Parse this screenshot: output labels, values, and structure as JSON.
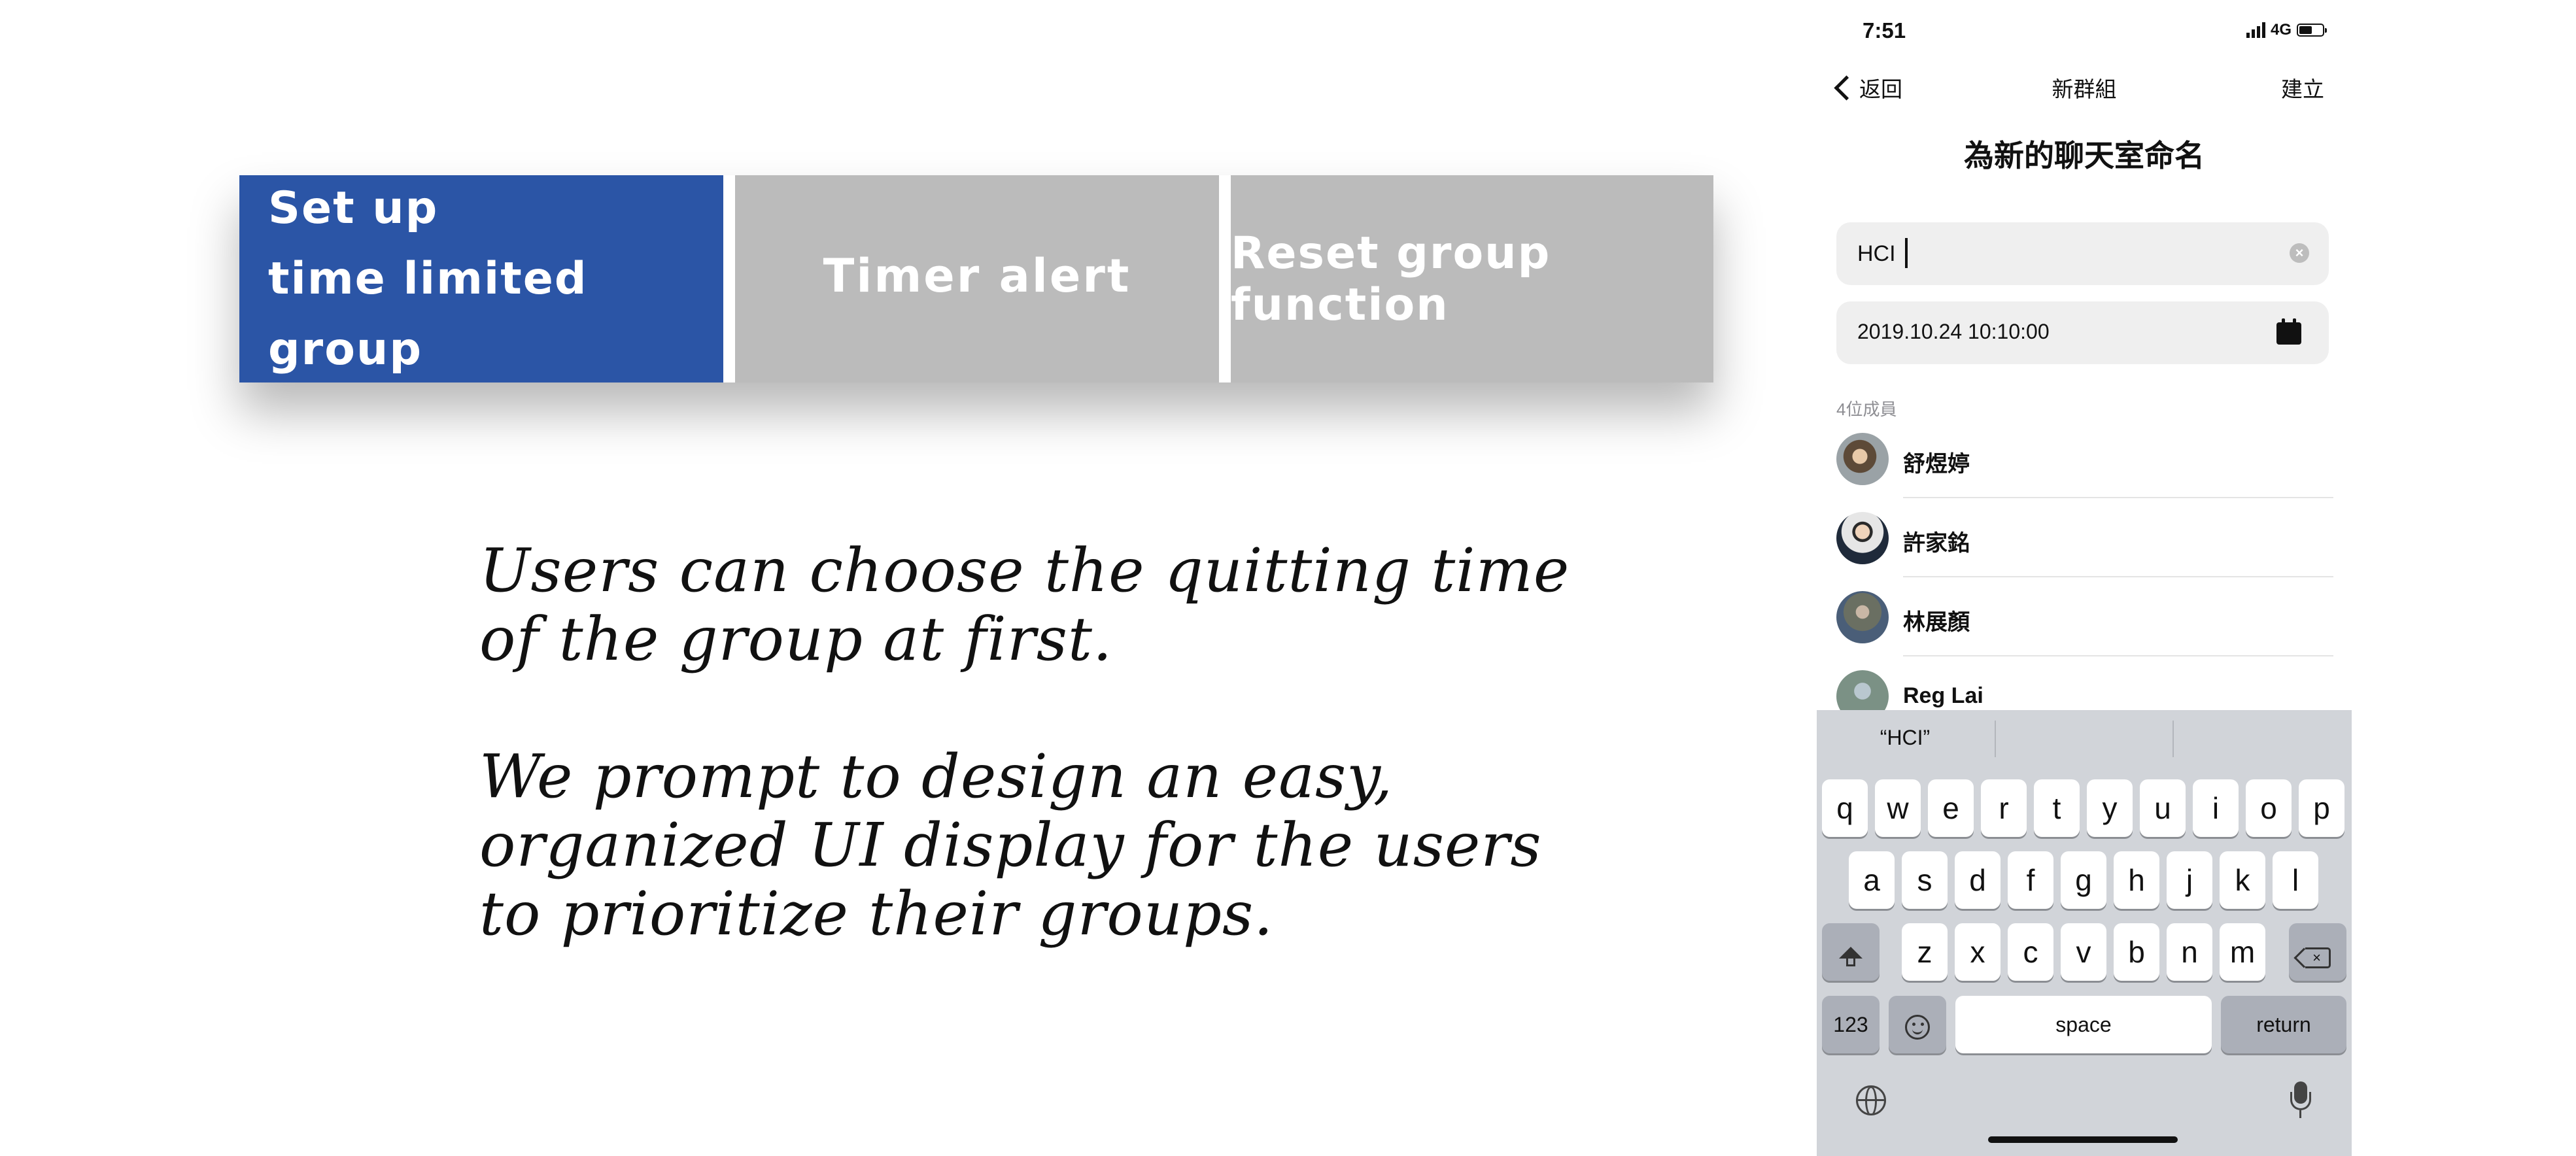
{
  "feature_tabs": [
    {
      "lines": [
        "Set up",
        "time limited group"
      ],
      "active": true
    },
    {
      "label": "Timer alert",
      "active": false
    },
    {
      "label": "Reset group function",
      "active": false
    }
  ],
  "description": {
    "paragraph1": "Users can choose the quitting time of the group at first.",
    "paragraph2": "We prompt to design an easy, organized UI display for the users to prioritize their groups."
  },
  "colors": {
    "active_tab": "#2b55a6",
    "inactive_tab": "#bbbbbb",
    "keyboard_bg": "#d1d4d9"
  },
  "phone": {
    "status_bar": {
      "time": "7:51",
      "network": "4G"
    },
    "nav": {
      "back_label": "返回",
      "title": "新群組",
      "action_label": "建立"
    },
    "heading": "為新的聊天室命名",
    "name_field": {
      "value": "HCI"
    },
    "date_field": {
      "value": "2019.10.24 10:10:00"
    },
    "members_label": "4位成員",
    "members": [
      {
        "name": "舒煜婷"
      },
      {
        "name": "許家銘"
      },
      {
        "name": "林展顏"
      },
      {
        "name": "Reg Lai"
      }
    ],
    "keyboard": {
      "suggestions": [
        "“HCI”",
        "",
        ""
      ],
      "row1": [
        "q",
        "w",
        "e",
        "r",
        "t",
        "y",
        "u",
        "i",
        "o",
        "p"
      ],
      "row2": [
        "a",
        "s",
        "d",
        "f",
        "g",
        "h",
        "j",
        "k",
        "l"
      ],
      "row3": [
        "z",
        "x",
        "c",
        "v",
        "b",
        "n",
        "m"
      ],
      "numbers_label": "123",
      "space_label": "space",
      "return_label": "return"
    }
  }
}
